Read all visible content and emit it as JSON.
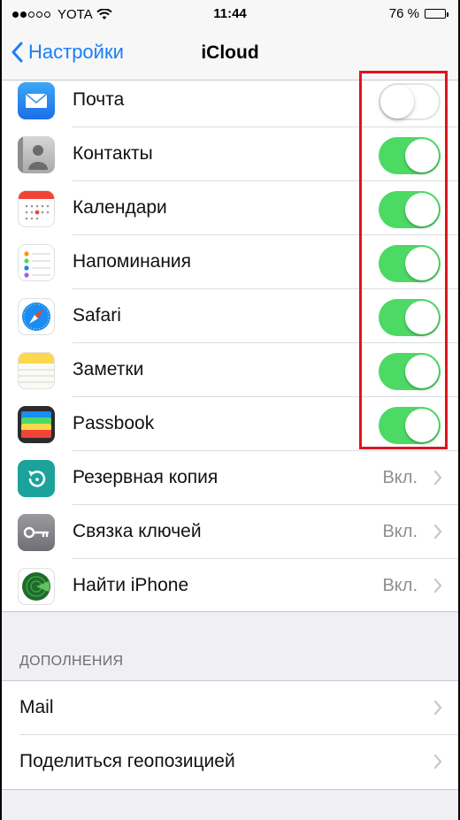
{
  "status_bar": {
    "carrier": "YOTA",
    "time": "11:44",
    "battery": "76 %",
    "battery_level": 0.76
  },
  "nav": {
    "back_label": "Настройки",
    "title": "iCloud"
  },
  "apps": [
    {
      "label": "Почта",
      "icon": "mail-icon",
      "toggle": "off"
    },
    {
      "label": "Контакты",
      "icon": "contacts-icon",
      "toggle": "on"
    },
    {
      "label": "Календари",
      "icon": "calendar-icon",
      "toggle": "on"
    },
    {
      "label": "Напоминания",
      "icon": "reminders-icon",
      "toggle": "on"
    },
    {
      "label": "Safari",
      "icon": "safari-icon",
      "toggle": "on"
    },
    {
      "label": "Заметки",
      "icon": "notes-icon",
      "toggle": "on"
    },
    {
      "label": "Passbook",
      "icon": "passbook-icon",
      "toggle": "on"
    },
    {
      "label": "Резервная копия",
      "icon": "backup-icon",
      "value": "Вкл."
    },
    {
      "label": "Связка ключей",
      "icon": "keychain-icon",
      "value": "Вкл."
    },
    {
      "label": "Найти iPhone",
      "icon": "find-iphone-icon",
      "value": "Вкл."
    }
  ],
  "extras": {
    "header": "ДОПОЛНЕНИЯ",
    "items": [
      {
        "label": "Mail"
      },
      {
        "label": "Поделиться геопозицией"
      }
    ]
  },
  "colors": {
    "accent": "#1a7ff5",
    "toggle_on": "#4cd964",
    "highlight": "#e0141b"
  }
}
